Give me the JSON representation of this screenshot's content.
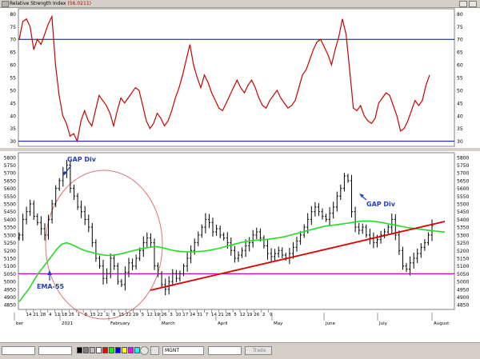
{
  "window": {
    "title": "Relative Strength Index",
    "rsi_value": "(56.0211)"
  },
  "rsi_panel": {
    "y_ticks": [
      "80",
      "75",
      "70",
      "65",
      "60",
      "55",
      "50",
      "45",
      "40",
      "35",
      "30"
    ],
    "upper_level": 70,
    "lower_level": 30,
    "line_color": "#cc0000",
    "level_color": "#0000cc"
  },
  "price_panel": {
    "y_ticks": [
      "5800",
      "5750",
      "5700",
      "5650",
      "5600",
      "5550",
      "5500",
      "5450",
      "5400",
      "5350",
      "5300",
      "5250",
      "5200",
      "5150",
      "5100",
      "5050",
      "5000",
      "4950",
      "4900",
      "4850"
    ],
    "support_level": 5050,
    "ema_color": "#22dd22",
    "trendline_color": "#dd0000",
    "support_color": "#cc00cc"
  },
  "annotations": {
    "gap_div_1": "GAP Div",
    "gap_div_2": "GAP Div",
    "ema": "EMA-55"
  },
  "x_axis": {
    "day_ticks": [
      "14",
      "21",
      "28",
      "4",
      "11",
      "18",
      "25",
      "1",
      "8",
      "15",
      "22",
      "1",
      "8",
      "15",
      "22",
      "29",
      "5",
      "12",
      "19",
      "26",
      "3",
      "10",
      "17",
      "24",
      "31",
      "7",
      "14",
      "21",
      "28",
      "5",
      "12",
      "19",
      "26",
      "2",
      "9"
    ],
    "month_labels": [
      "ber",
      "2021",
      "February",
      "March",
      "April",
      "May",
      "June",
      "July",
      "August"
    ]
  },
  "toolbar": {
    "symbol": "MGNT",
    "trade_label": "Trade",
    "swatch_colors": [
      "#000000",
      "#808080",
      "#c0c0c0",
      "#ffffff",
      "#ff0000",
      "#00ff00",
      "#0000ff",
      "#ffff00",
      "#ff00ff",
      "#00ffff"
    ]
  },
  "chart_data": [
    {
      "type": "line",
      "title": "Relative Strength Index",
      "series": [
        {
          "name": "RSI",
          "values": [
            70,
            77,
            78,
            75,
            66,
            70,
            68,
            72,
            76,
            79,
            60,
            48,
            40,
            37,
            32,
            33,
            30,
            38,
            42,
            38,
            36,
            42,
            48,
            46,
            44,
            41,
            36,
            42,
            47,
            45,
            47,
            49,
            51,
            50,
            44,
            38,
            35,
            37,
            41,
            39,
            36,
            38,
            42,
            47,
            51,
            56,
            62,
            68,
            60,
            55,
            51,
            56,
            53,
            49,
            46,
            43,
            42,
            45,
            48,
            51,
            54,
            51,
            49,
            52,
            54,
            51,
            47,
            44,
            43,
            46,
            48,
            50,
            47,
            45,
            43,
            44,
            46,
            51,
            56,
            58,
            62,
            66,
            69,
            70,
            67,
            64,
            60,
            66,
            71,
            78,
            72,
            58,
            43,
            42,
            44,
            40,
            38,
            37,
            39,
            45,
            47,
            49,
            48,
            44,
            40,
            34,
            35,
            38,
            42,
            46,
            44,
            46,
            52,
            56
          ]
        }
      ],
      "ylim": [
        28,
        82
      ]
    },
    {
      "type": "line",
      "title": "",
      "series": [
        {
          "name": "Price",
          "values": [
            5300,
            5400,
            5450,
            5500,
            5420,
            5380,
            5340,
            5300,
            5400,
            5500,
            5600,
            5650,
            5700,
            5750,
            5600,
            5550,
            5480,
            5450,
            5400,
            5350,
            5250,
            5150,
            5100,
            5020,
            5050,
            5150,
            5100,
            5000,
            4980,
            5060,
            5120,
            5100,
            5150,
            5200,
            5250,
            5280,
            5250,
            5100,
            5050,
            4980,
            4950,
            5000,
            5050,
            5020,
            5050,
            5100,
            5150,
            5200,
            5250,
            5300,
            5350,
            5400,
            5380,
            5320,
            5340,
            5300,
            5280,
            5250,
            5200,
            5150,
            5170,
            5200,
            5230,
            5250,
            5300,
            5320,
            5280,
            5230,
            5180,
            5160,
            5180,
            5200,
            5170,
            5150,
            5180,
            5220,
            5260,
            5300,
            5350,
            5400,
            5450,
            5480,
            5450,
            5420,
            5400,
            5440,
            5480,
            5550,
            5600,
            5680,
            5650,
            5450,
            5350,
            5330,
            5350,
            5300,
            5280,
            5250,
            5270,
            5300,
            5320,
            5350,
            5400,
            5300,
            5200,
            5100,
            5080,
            5120,
            5150,
            5180,
            5220,
            5250,
            5300,
            5360
          ]
        },
        {
          "name": "EMA-55",
          "values": [
            4870,
            4910,
            4950,
            5000,
            5050,
            5090,
            5130,
            5170,
            5210,
            5240,
            5250,
            5240,
            5225,
            5210,
            5198,
            5190,
            5182,
            5175,
            5170,
            5168,
            5170,
            5175,
            5182,
            5190,
            5198,
            5205,
            5212,
            5218,
            5222,
            5225,
            5220,
            5212,
            5204,
            5198,
            5194,
            5192,
            5191,
            5191,
            5193,
            5196,
            5200,
            5206,
            5212,
            5220,
            5228,
            5236,
            5244,
            5252,
            5258,
            5262,
            5266,
            5268,
            5270,
            5274,
            5278,
            5282,
            5288,
            5296,
            5304,
            5312,
            5320,
            5328,
            5336,
            5344,
            5352,
            5358,
            5362,
            5365,
            5370,
            5374,
            5378,
            5384,
            5388,
            5390,
            5390,
            5388,
            5384,
            5378,
            5372,
            5366,
            5360,
            5354,
            5348,
            5344,
            5340,
            5336,
            5332,
            5328,
            5325,
            5322,
            5318
          ]
        }
      ],
      "ylim": [
        4820,
        5830
      ]
    }
  ]
}
